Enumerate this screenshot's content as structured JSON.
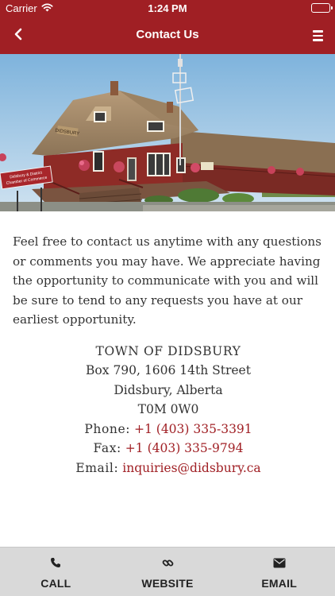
{
  "status_bar": {
    "carrier": "Carrier",
    "time": "1:24 PM",
    "wifi_icon": "wifi-icon",
    "battery_icon": "battery-icon",
    "battery_level": 1.0
  },
  "nav_bar": {
    "title": "Contact Us",
    "back_icon": "chevron-left-icon",
    "menu_icon": "hamburger-menu-icon",
    "background": "#a01f24"
  },
  "hero": {
    "description": "photo of Didsbury historic train station",
    "station_sign": "DIDSBURY",
    "chamber_sign": [
      "Didsbury & District",
      "Chamber of Commerce"
    ]
  },
  "intro": "Feel free to contact us anytime with any questions or comments you may have. We appreciate having the opportunity to communicate with you and will be sure to tend to any requests you have at our earliest opportunity.",
  "address": {
    "name": "TOWN OF DIDSBURY",
    "line1": "Box 790, 1606 14th Street",
    "line2": "Didsbury, Alberta",
    "postal": "T0M 0W0",
    "phone_label": "Phone:",
    "phone": "+1 (403) 335-3391",
    "fax_label": "Fax:",
    "fax": "+1 (403) 335-9794",
    "email_label": "Email:",
    "email": "inquiries@didsbury.ca"
  },
  "tab_bar": {
    "items": [
      {
        "label": "CALL",
        "icon": "phone-icon"
      },
      {
        "label": "WEBSITE",
        "icon": "link-icon"
      },
      {
        "label": "EMAIL",
        "icon": "envelope-icon"
      }
    ]
  },
  "colors": {
    "accent": "#a01f24",
    "link": "#a01f24",
    "tab_bar_bg": "#d9d9d9"
  }
}
